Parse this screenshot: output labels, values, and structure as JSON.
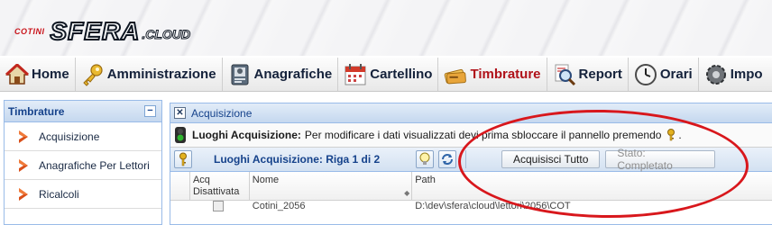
{
  "logo": {
    "brand": "COTINI",
    "product": "SFERA",
    "suffix": ".CLOUD"
  },
  "nav": {
    "items": [
      {
        "label": "Home",
        "icon": "home-icon"
      },
      {
        "label": "Amministrazione",
        "icon": "key-icon"
      },
      {
        "label": "Anagrafiche",
        "icon": "id-card-icon"
      },
      {
        "label": "Cartellino",
        "icon": "calendar-icon"
      },
      {
        "label": "Timbrature",
        "icon": "cards-icon",
        "active": true
      },
      {
        "label": "Report",
        "icon": "magnifier-icon"
      },
      {
        "label": "Orari",
        "icon": "clock-icon"
      },
      {
        "label": "Impo",
        "icon": "gears-icon"
      }
    ]
  },
  "sidebar": {
    "title": "Timbrature",
    "collapse_symbol": "−",
    "items": [
      {
        "label": "Acquisizione"
      },
      {
        "label": "Anagrafiche Per Lettori"
      },
      {
        "label": "Ricalcoli"
      }
    ]
  },
  "panel": {
    "title": "Acquisizione",
    "close_symbol": "✕",
    "info_label": "Luoghi Acquisizione:",
    "info_text": "Per modificare i dati visualizzati devi prima sbloccare il pannello premendo",
    "info_end": ".",
    "toolbar_title": "Luoghi Acquisizione: Riga 1 di 2",
    "acquire_button": "Acquisisci Tutto",
    "status_button": "Stato: Completato",
    "columns": [
      "Acq Disattivata",
      "Nome",
      "Path"
    ],
    "sort_indicator": "◆",
    "rows": [
      {
        "nome": "Cotini_2056",
        "path": "D:\\dev\\sfera\\cloud\\lettori\\2056\\COT"
      }
    ]
  },
  "colors": {
    "accent": "#15428b",
    "active_nav": "#b0121a",
    "annotation": "#d8171c"
  }
}
